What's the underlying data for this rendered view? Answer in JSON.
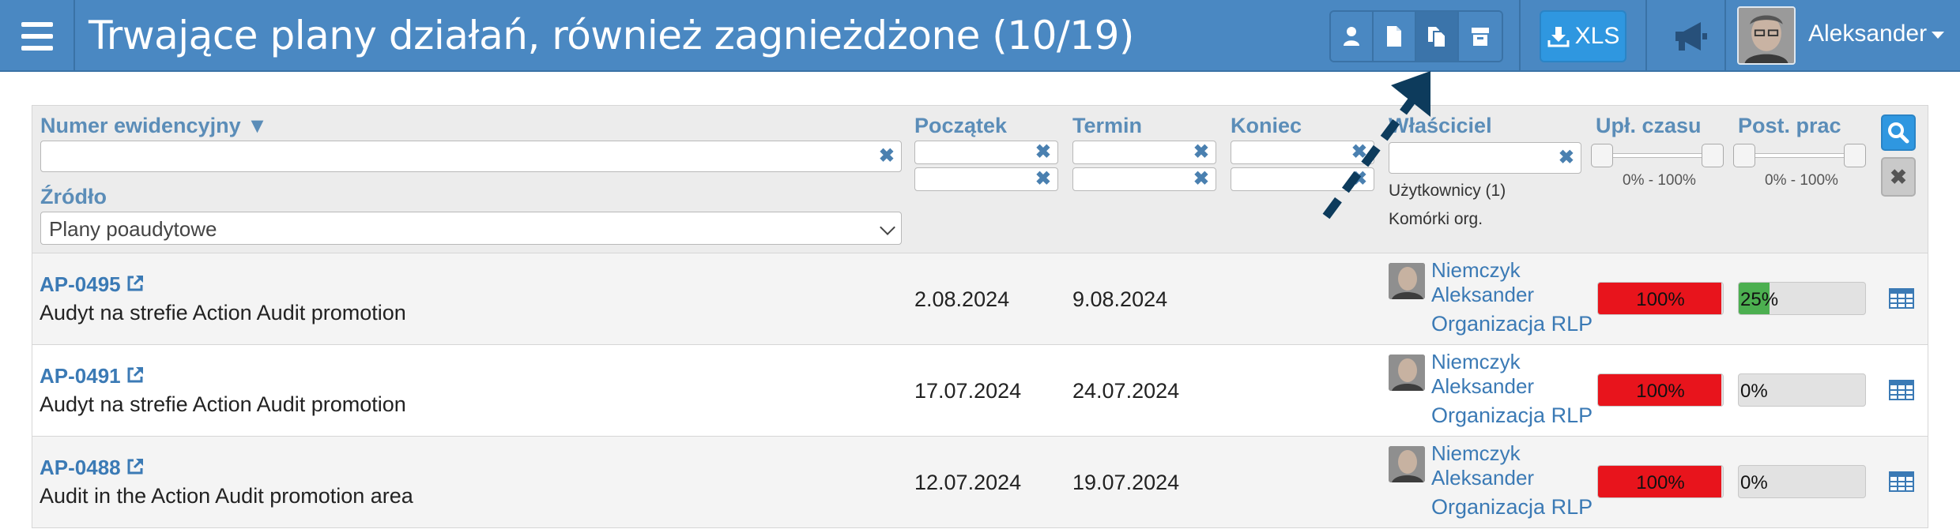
{
  "header": {
    "title": "Trwające plany działań, również zagnieżdżone (10/19)",
    "xls_label": "XLS",
    "user_name": "Aleksander"
  },
  "filters": {
    "numer_label": "Numer ewidencyjny ▼",
    "zrodlo_label": "Źródło",
    "zrodlo_value": "Plany poaudytowe",
    "poczatek_label": "Początek",
    "termin_label": "Termin",
    "koniec_label": "Koniec",
    "wlasciciel_label": "Właściciel",
    "uzytkownicy_note": "Użytkownicy (1)",
    "komorki_note": "Komórki org.",
    "upl_label": "Upł. czasu",
    "upl_range": "0% - 100%",
    "post_label": "Post. prac",
    "post_range": "0% - 100%",
    "clear_glyph": "✖"
  },
  "rows": [
    {
      "code": "AP-0495",
      "description": "Audyt na strefie Action Audit promotion",
      "start": "2.08.2024",
      "deadline": "9.08.2024",
      "owner_line1": "Niemczyk",
      "owner_line2": "Aleksander",
      "org": "Organizacja RLP",
      "time_pct": "100%",
      "time_value": 1.0,
      "work_pct": "25%",
      "work_value": 0.25
    },
    {
      "code": "AP-0491",
      "description": "Audyt na strefie Action Audit promotion",
      "start": "17.07.2024",
      "deadline": "24.07.2024",
      "owner_line1": "Niemczyk",
      "owner_line2": "Aleksander",
      "org": "Organizacja RLP",
      "time_pct": "100%",
      "time_value": 1.0,
      "work_pct": "0%",
      "work_value": 0
    },
    {
      "code": "AP-0488",
      "description": "Audit in the Action Audit promotion area",
      "start": "12.07.2024",
      "deadline": "19.07.2024",
      "owner_line1": "Niemczyk",
      "owner_line2": "Aleksander",
      "org": "Organizacja RLP",
      "time_pct": "100%",
      "time_value": 1.0,
      "work_pct": "0%",
      "work_value": 0
    }
  ],
  "colors": {
    "header_bg": "#4a88c2",
    "time_bar": "#e8141c",
    "work_bar": "#4caf50",
    "link": "#3b7ab5",
    "arrow": "#0d3b5c"
  }
}
